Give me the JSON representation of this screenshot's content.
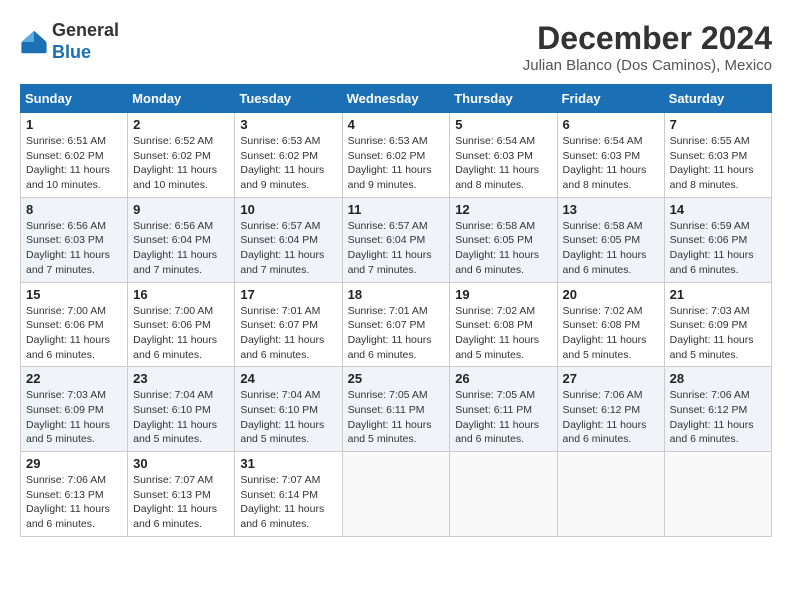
{
  "header": {
    "logo_general": "General",
    "logo_blue": "Blue",
    "month_title": "December 2024",
    "location": "Julian Blanco (Dos Caminos), Mexico"
  },
  "days_of_week": [
    "Sunday",
    "Monday",
    "Tuesday",
    "Wednesday",
    "Thursday",
    "Friday",
    "Saturday"
  ],
  "weeks": [
    [
      {
        "day": "1",
        "info": "Sunrise: 6:51 AM\nSunset: 6:02 PM\nDaylight: 11 hours and 10 minutes."
      },
      {
        "day": "2",
        "info": "Sunrise: 6:52 AM\nSunset: 6:02 PM\nDaylight: 11 hours and 10 minutes."
      },
      {
        "day": "3",
        "info": "Sunrise: 6:53 AM\nSunset: 6:02 PM\nDaylight: 11 hours and 9 minutes."
      },
      {
        "day": "4",
        "info": "Sunrise: 6:53 AM\nSunset: 6:02 PM\nDaylight: 11 hours and 9 minutes."
      },
      {
        "day": "5",
        "info": "Sunrise: 6:54 AM\nSunset: 6:03 PM\nDaylight: 11 hours and 8 minutes."
      },
      {
        "day": "6",
        "info": "Sunrise: 6:54 AM\nSunset: 6:03 PM\nDaylight: 11 hours and 8 minutes."
      },
      {
        "day": "7",
        "info": "Sunrise: 6:55 AM\nSunset: 6:03 PM\nDaylight: 11 hours and 8 minutes."
      }
    ],
    [
      {
        "day": "8",
        "info": "Sunrise: 6:56 AM\nSunset: 6:03 PM\nDaylight: 11 hours and 7 minutes."
      },
      {
        "day": "9",
        "info": "Sunrise: 6:56 AM\nSunset: 6:04 PM\nDaylight: 11 hours and 7 minutes."
      },
      {
        "day": "10",
        "info": "Sunrise: 6:57 AM\nSunset: 6:04 PM\nDaylight: 11 hours and 7 minutes."
      },
      {
        "day": "11",
        "info": "Sunrise: 6:57 AM\nSunset: 6:04 PM\nDaylight: 11 hours and 7 minutes."
      },
      {
        "day": "12",
        "info": "Sunrise: 6:58 AM\nSunset: 6:05 PM\nDaylight: 11 hours and 6 minutes."
      },
      {
        "day": "13",
        "info": "Sunrise: 6:58 AM\nSunset: 6:05 PM\nDaylight: 11 hours and 6 minutes."
      },
      {
        "day": "14",
        "info": "Sunrise: 6:59 AM\nSunset: 6:06 PM\nDaylight: 11 hours and 6 minutes."
      }
    ],
    [
      {
        "day": "15",
        "info": "Sunrise: 7:00 AM\nSunset: 6:06 PM\nDaylight: 11 hours and 6 minutes."
      },
      {
        "day": "16",
        "info": "Sunrise: 7:00 AM\nSunset: 6:06 PM\nDaylight: 11 hours and 6 minutes."
      },
      {
        "day": "17",
        "info": "Sunrise: 7:01 AM\nSunset: 6:07 PM\nDaylight: 11 hours and 6 minutes."
      },
      {
        "day": "18",
        "info": "Sunrise: 7:01 AM\nSunset: 6:07 PM\nDaylight: 11 hours and 6 minutes."
      },
      {
        "day": "19",
        "info": "Sunrise: 7:02 AM\nSunset: 6:08 PM\nDaylight: 11 hours and 5 minutes."
      },
      {
        "day": "20",
        "info": "Sunrise: 7:02 AM\nSunset: 6:08 PM\nDaylight: 11 hours and 5 minutes."
      },
      {
        "day": "21",
        "info": "Sunrise: 7:03 AM\nSunset: 6:09 PM\nDaylight: 11 hours and 5 minutes."
      }
    ],
    [
      {
        "day": "22",
        "info": "Sunrise: 7:03 AM\nSunset: 6:09 PM\nDaylight: 11 hours and 5 minutes."
      },
      {
        "day": "23",
        "info": "Sunrise: 7:04 AM\nSunset: 6:10 PM\nDaylight: 11 hours and 5 minutes."
      },
      {
        "day": "24",
        "info": "Sunrise: 7:04 AM\nSunset: 6:10 PM\nDaylight: 11 hours and 5 minutes."
      },
      {
        "day": "25",
        "info": "Sunrise: 7:05 AM\nSunset: 6:11 PM\nDaylight: 11 hours and 5 minutes."
      },
      {
        "day": "26",
        "info": "Sunrise: 7:05 AM\nSunset: 6:11 PM\nDaylight: 11 hours and 6 minutes."
      },
      {
        "day": "27",
        "info": "Sunrise: 7:06 AM\nSunset: 6:12 PM\nDaylight: 11 hours and 6 minutes."
      },
      {
        "day": "28",
        "info": "Sunrise: 7:06 AM\nSunset: 6:12 PM\nDaylight: 11 hours and 6 minutes."
      }
    ],
    [
      {
        "day": "29",
        "info": "Sunrise: 7:06 AM\nSunset: 6:13 PM\nDaylight: 11 hours and 6 minutes."
      },
      {
        "day": "30",
        "info": "Sunrise: 7:07 AM\nSunset: 6:13 PM\nDaylight: 11 hours and 6 minutes."
      },
      {
        "day": "31",
        "info": "Sunrise: 7:07 AM\nSunset: 6:14 PM\nDaylight: 11 hours and 6 minutes."
      },
      {
        "day": "",
        "info": ""
      },
      {
        "day": "",
        "info": ""
      },
      {
        "day": "",
        "info": ""
      },
      {
        "day": "",
        "info": ""
      }
    ]
  ]
}
